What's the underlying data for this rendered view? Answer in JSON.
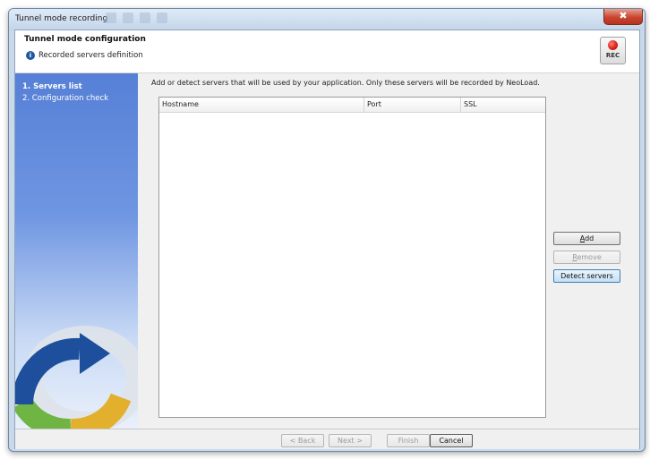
{
  "window": {
    "title": "Tunnel mode recording",
    "close_glyph": "✖"
  },
  "header": {
    "title": "Tunnel mode configuration",
    "subtitle": "Recorded servers definition",
    "info_glyph": "i",
    "rec_label": "REC"
  },
  "sidebar": {
    "steps": [
      {
        "label": "1. Servers list",
        "active": true
      },
      {
        "label": "2. Configuration check",
        "active": false
      }
    ]
  },
  "main": {
    "description": "Add or detect servers that will be used by your application. Only these servers will be recorded by NeoLoad.",
    "table": {
      "columns": [
        "Hostname",
        "Port",
        "SSL"
      ],
      "rows": []
    },
    "buttons": {
      "add": {
        "label": "Add",
        "mnemonic": "A",
        "rest": "dd",
        "enabled": true
      },
      "remove": {
        "label": "Remove",
        "mnemonic": "R",
        "rest": "emove",
        "enabled": false
      },
      "detect": {
        "label": "Detect servers",
        "enabled": true
      }
    }
  },
  "footer": {
    "back": "< Back",
    "next": "Next >",
    "finish": "Finish",
    "cancel": "Cancel"
  },
  "colors": {
    "sidebar_top": "#5680d6",
    "logo_blue": "#1d4f9c",
    "logo_green": "#6fb544",
    "logo_yellow": "#e3b02d",
    "rec_red": "#d71f14"
  },
  "icons": [
    "info-icon",
    "rec-icon",
    "close-icon",
    "refresh-arrow-logo"
  ]
}
